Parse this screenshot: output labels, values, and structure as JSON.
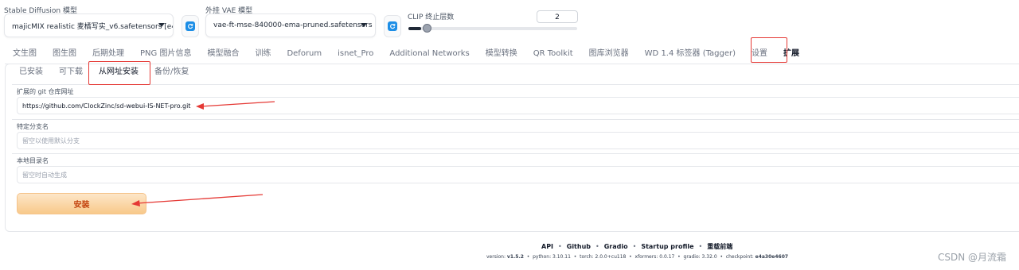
{
  "top": {
    "sd_model_label": "Stable Diffusion 模型",
    "sd_model_value": "majicMIX realistic 麦橘写实_v6.safetensors [e4a",
    "vae_label": "外挂 VAE 模型",
    "vae_value": "vae-ft-mse-840000-ema-pruned.safetensors",
    "clip_label": "CLIP 终止层数",
    "clip_value": "2",
    "clip_slider_fraction": 0.02
  },
  "main_tabs": [
    "文生图",
    "图生图",
    "后期处理",
    "PNG 图片信息",
    "模型融合",
    "训练",
    "Deforum",
    "isnet_Pro",
    "Additional Networks",
    "模型转换",
    "QR Toolkit",
    "图库浏览器",
    "WD 1.4 标签器 (Tagger)",
    "设置",
    "扩展"
  ],
  "sub_tabs": [
    "已安装",
    "可下载",
    "从网址安装",
    "备份/恢复"
  ],
  "fields": {
    "git_url_label": "扩展的 git 仓库网址",
    "git_url_value": "https://github.com/ClockZinc/sd-webui-IS-NET-pro.git",
    "branch_label": "特定分支名",
    "branch_placeholder": "留空以使用默认分支",
    "dir_label": "本地目录名",
    "dir_placeholder": "留空时自动生成"
  },
  "install_button": "安装",
  "footer": {
    "links": [
      "API",
      "Github",
      "Gradio",
      "Startup profile",
      "重载前端"
    ],
    "separator": "•",
    "version_label": "version:",
    "version_value": "v1.5.2",
    "python": "python: 3.10.11",
    "torch": "torch: 2.0.0+cu118",
    "xformers": "xformers: 0.0.17",
    "gradio": "gradio: 3.32.0",
    "checkpoint_label": "checkpoint:",
    "checkpoint_value": "e4a30e4607"
  },
  "watermark": "CSDN @月流霜",
  "annotation_color": "#e53935",
  "accent_color": "#1d8ee6"
}
